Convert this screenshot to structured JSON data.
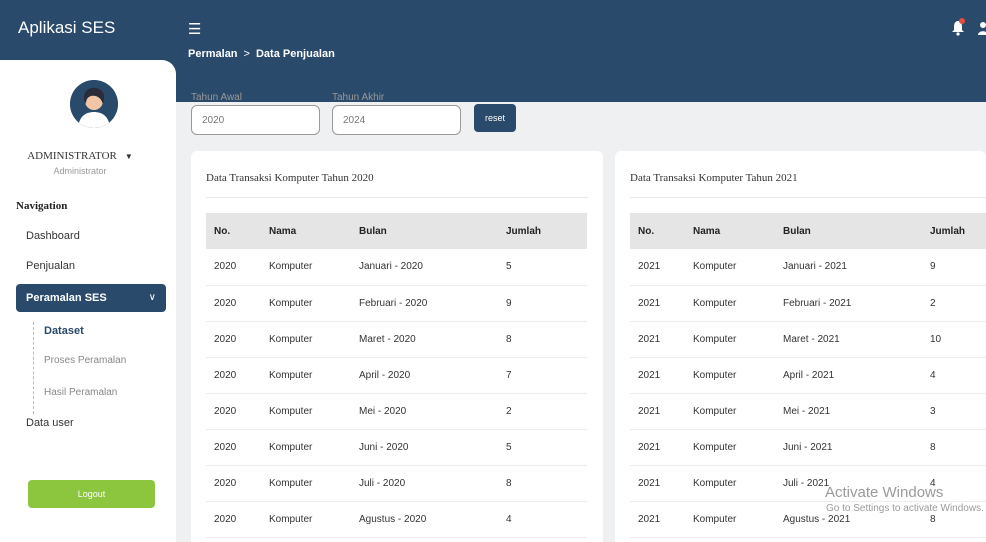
{
  "app": {
    "title": "Aplikasi SES"
  },
  "breadcrumb": {
    "parent": "Permalan",
    "separator": ">",
    "current": "Data Penjualan"
  },
  "user": {
    "name": "ADMINISTRATOR",
    "role": "Administrator"
  },
  "nav": {
    "heading": "Navigation",
    "items": [
      "Dashboard",
      "Penjualan"
    ],
    "active": "Peramalan SES",
    "sub": [
      "Dataset",
      "Proses Peramalan",
      "Hasil Peramalan"
    ],
    "after": "Data user"
  },
  "logout_label": "Logout",
  "filter": {
    "start_label": "Tahun Awal",
    "start_value": "2020",
    "end_label": "Tahun Akhir",
    "end_value": "2024",
    "reset_label": "reset"
  },
  "columns": [
    "No.",
    "Nama",
    "Bulan",
    "Jumlah"
  ],
  "tables": [
    {
      "title": "Data Transaksi Komputer Tahun 2020",
      "rows": [
        [
          "2020",
          "Komputer",
          "Januari - 2020",
          "5"
        ],
        [
          "2020",
          "Komputer",
          "Februari - 2020",
          "9"
        ],
        [
          "2020",
          "Komputer",
          "Maret - 2020",
          "8"
        ],
        [
          "2020",
          "Komputer",
          "April - 2020",
          "7"
        ],
        [
          "2020",
          "Komputer",
          "Mei - 2020",
          "2"
        ],
        [
          "2020",
          "Komputer",
          "Juni - 2020",
          "5"
        ],
        [
          "2020",
          "Komputer",
          "Juli - 2020",
          "8"
        ],
        [
          "2020",
          "Komputer",
          "Agustus - 2020",
          "4"
        ]
      ]
    },
    {
      "title": "Data Transaksi Komputer Tahun 2021",
      "rows": [
        [
          "2021",
          "Komputer",
          "Januari - 2021",
          "9"
        ],
        [
          "2021",
          "Komputer",
          "Februari - 2021",
          "2"
        ],
        [
          "2021",
          "Komputer",
          "Maret - 2021",
          "10"
        ],
        [
          "2021",
          "Komputer",
          "April - 2021",
          "4"
        ],
        [
          "2021",
          "Komputer",
          "Mei - 2021",
          "3"
        ],
        [
          "2021",
          "Komputer",
          "Juni - 2021",
          "8"
        ],
        [
          "2021",
          "Komputer",
          "Juli - 2021",
          "4"
        ],
        [
          "2021",
          "Komputer",
          "Agustus - 2021",
          "8"
        ]
      ]
    }
  ],
  "watermark": {
    "line1": "Activate Windows",
    "line2": "Go to Settings to activate Windows."
  },
  "colors": {
    "primary": "#294a6b",
    "logout": "#8cc63f",
    "notification": "#e74c3c"
  }
}
